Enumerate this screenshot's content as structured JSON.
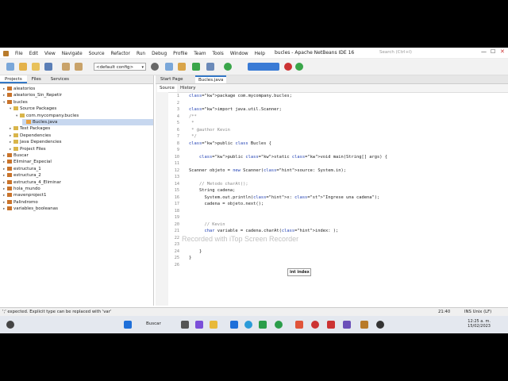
{
  "window": {
    "title": "bucles - Apache NetBeans IDE 16",
    "search_placeholder": "Search (Ctrl+I)"
  },
  "menu": [
    "File",
    "Edit",
    "View",
    "Navigate",
    "Source",
    "Refactor",
    "Run",
    "Debug",
    "Profile",
    "Team",
    "Tools",
    "Window",
    "Help"
  ],
  "toolbar": {
    "config": "<default config>"
  },
  "left_tabs": [
    "Projects",
    "Files",
    "Services"
  ],
  "tree": [
    {
      "label": "aleatorios",
      "depth": 0
    },
    {
      "label": "aleatorios_Sin_Repetir",
      "depth": 0
    },
    {
      "label": "bucles",
      "depth": 0
    },
    {
      "label": "Source Packages",
      "depth": 1
    },
    {
      "label": "com.mycompany.bucles",
      "depth": 2
    },
    {
      "label": "Bucles.java",
      "depth": 3
    },
    {
      "label": "Test Packages",
      "depth": 1
    },
    {
      "label": "Dependencies",
      "depth": 1
    },
    {
      "label": "Java Dependencies",
      "depth": 1
    },
    {
      "label": "Project Files",
      "depth": 1
    },
    {
      "label": "Buscar",
      "depth": 0
    },
    {
      "label": "Eliminar_Especial",
      "depth": 0
    },
    {
      "label": "estructura_1",
      "depth": 0
    },
    {
      "label": "estructura_2",
      "depth": 0
    },
    {
      "label": "estructura_4_Eliminar",
      "depth": 0
    },
    {
      "label": "hola_mundo",
      "depth": 0
    },
    {
      "label": "mavenproject1",
      "depth": 0
    },
    {
      "label": "Palindromo",
      "depth": 0
    },
    {
      "label": "variables_booleanas",
      "depth": 0
    }
  ],
  "editor_tabs": [
    "Start Page",
    "Bucles.java"
  ],
  "editor_subtabs": [
    "Source",
    "History"
  ],
  "code_lines": [
    {
      "n": "1",
      "text": "package com.mycompany.bucles;"
    },
    {
      "n": "2",
      "text": ""
    },
    {
      "n": "3",
      "text": "import java.util.Scanner;"
    },
    {
      "n": "4",
      "text": "/**"
    },
    {
      "n": "5",
      "text": " *"
    },
    {
      "n": "6",
      "text": " * @author Kevin"
    },
    {
      "n": "7",
      "text": " */"
    },
    {
      "n": "8",
      "text": "public class Bucles {"
    },
    {
      "n": "9",
      "text": ""
    },
    {
      "n": "10",
      "text": "    public static void main(String[] args) {"
    },
    {
      "n": "11",
      "text": ""
    },
    {
      "n": "12",
      "text": "Scanner objeto = new Scanner(source: System.in);"
    },
    {
      "n": "13",
      "text": ""
    },
    {
      "n": "14",
      "text": "    // Metodo charAt();"
    },
    {
      "n": "15",
      "text": "    String cadena;"
    },
    {
      "n": "16",
      "text": "      System.out.println(x: \"Ingrese una cadena\");"
    },
    {
      "n": "17",
      "text": "      cadena = objeto.next();"
    },
    {
      "n": "18",
      "text": ""
    },
    {
      "n": "19",
      "text": ""
    },
    {
      "n": "20",
      "text": "      // Kevin"
    },
    {
      "n": "21",
      "text": "      char variable = cadena.charAt(index: );"
    },
    {
      "n": "22",
      "text": ""
    },
    {
      "n": "23",
      "text": ""
    },
    {
      "n": "24",
      "text": "    }"
    },
    {
      "n": "25",
      "text": "}"
    },
    {
      "n": "26",
      "text": ""
    }
  ],
  "tooltip": "int index",
  "watermark": "Recorded with iTop Screen Recorder",
  "status": {
    "message": "';' expected. Explicit type can be replaced with 'var'",
    "position": "21:40",
    "mode": "INS  Unix (LF)"
  },
  "taskbar": {
    "search": "Buscar",
    "time": "12:25 a. m.",
    "date": "15/02/2023"
  }
}
